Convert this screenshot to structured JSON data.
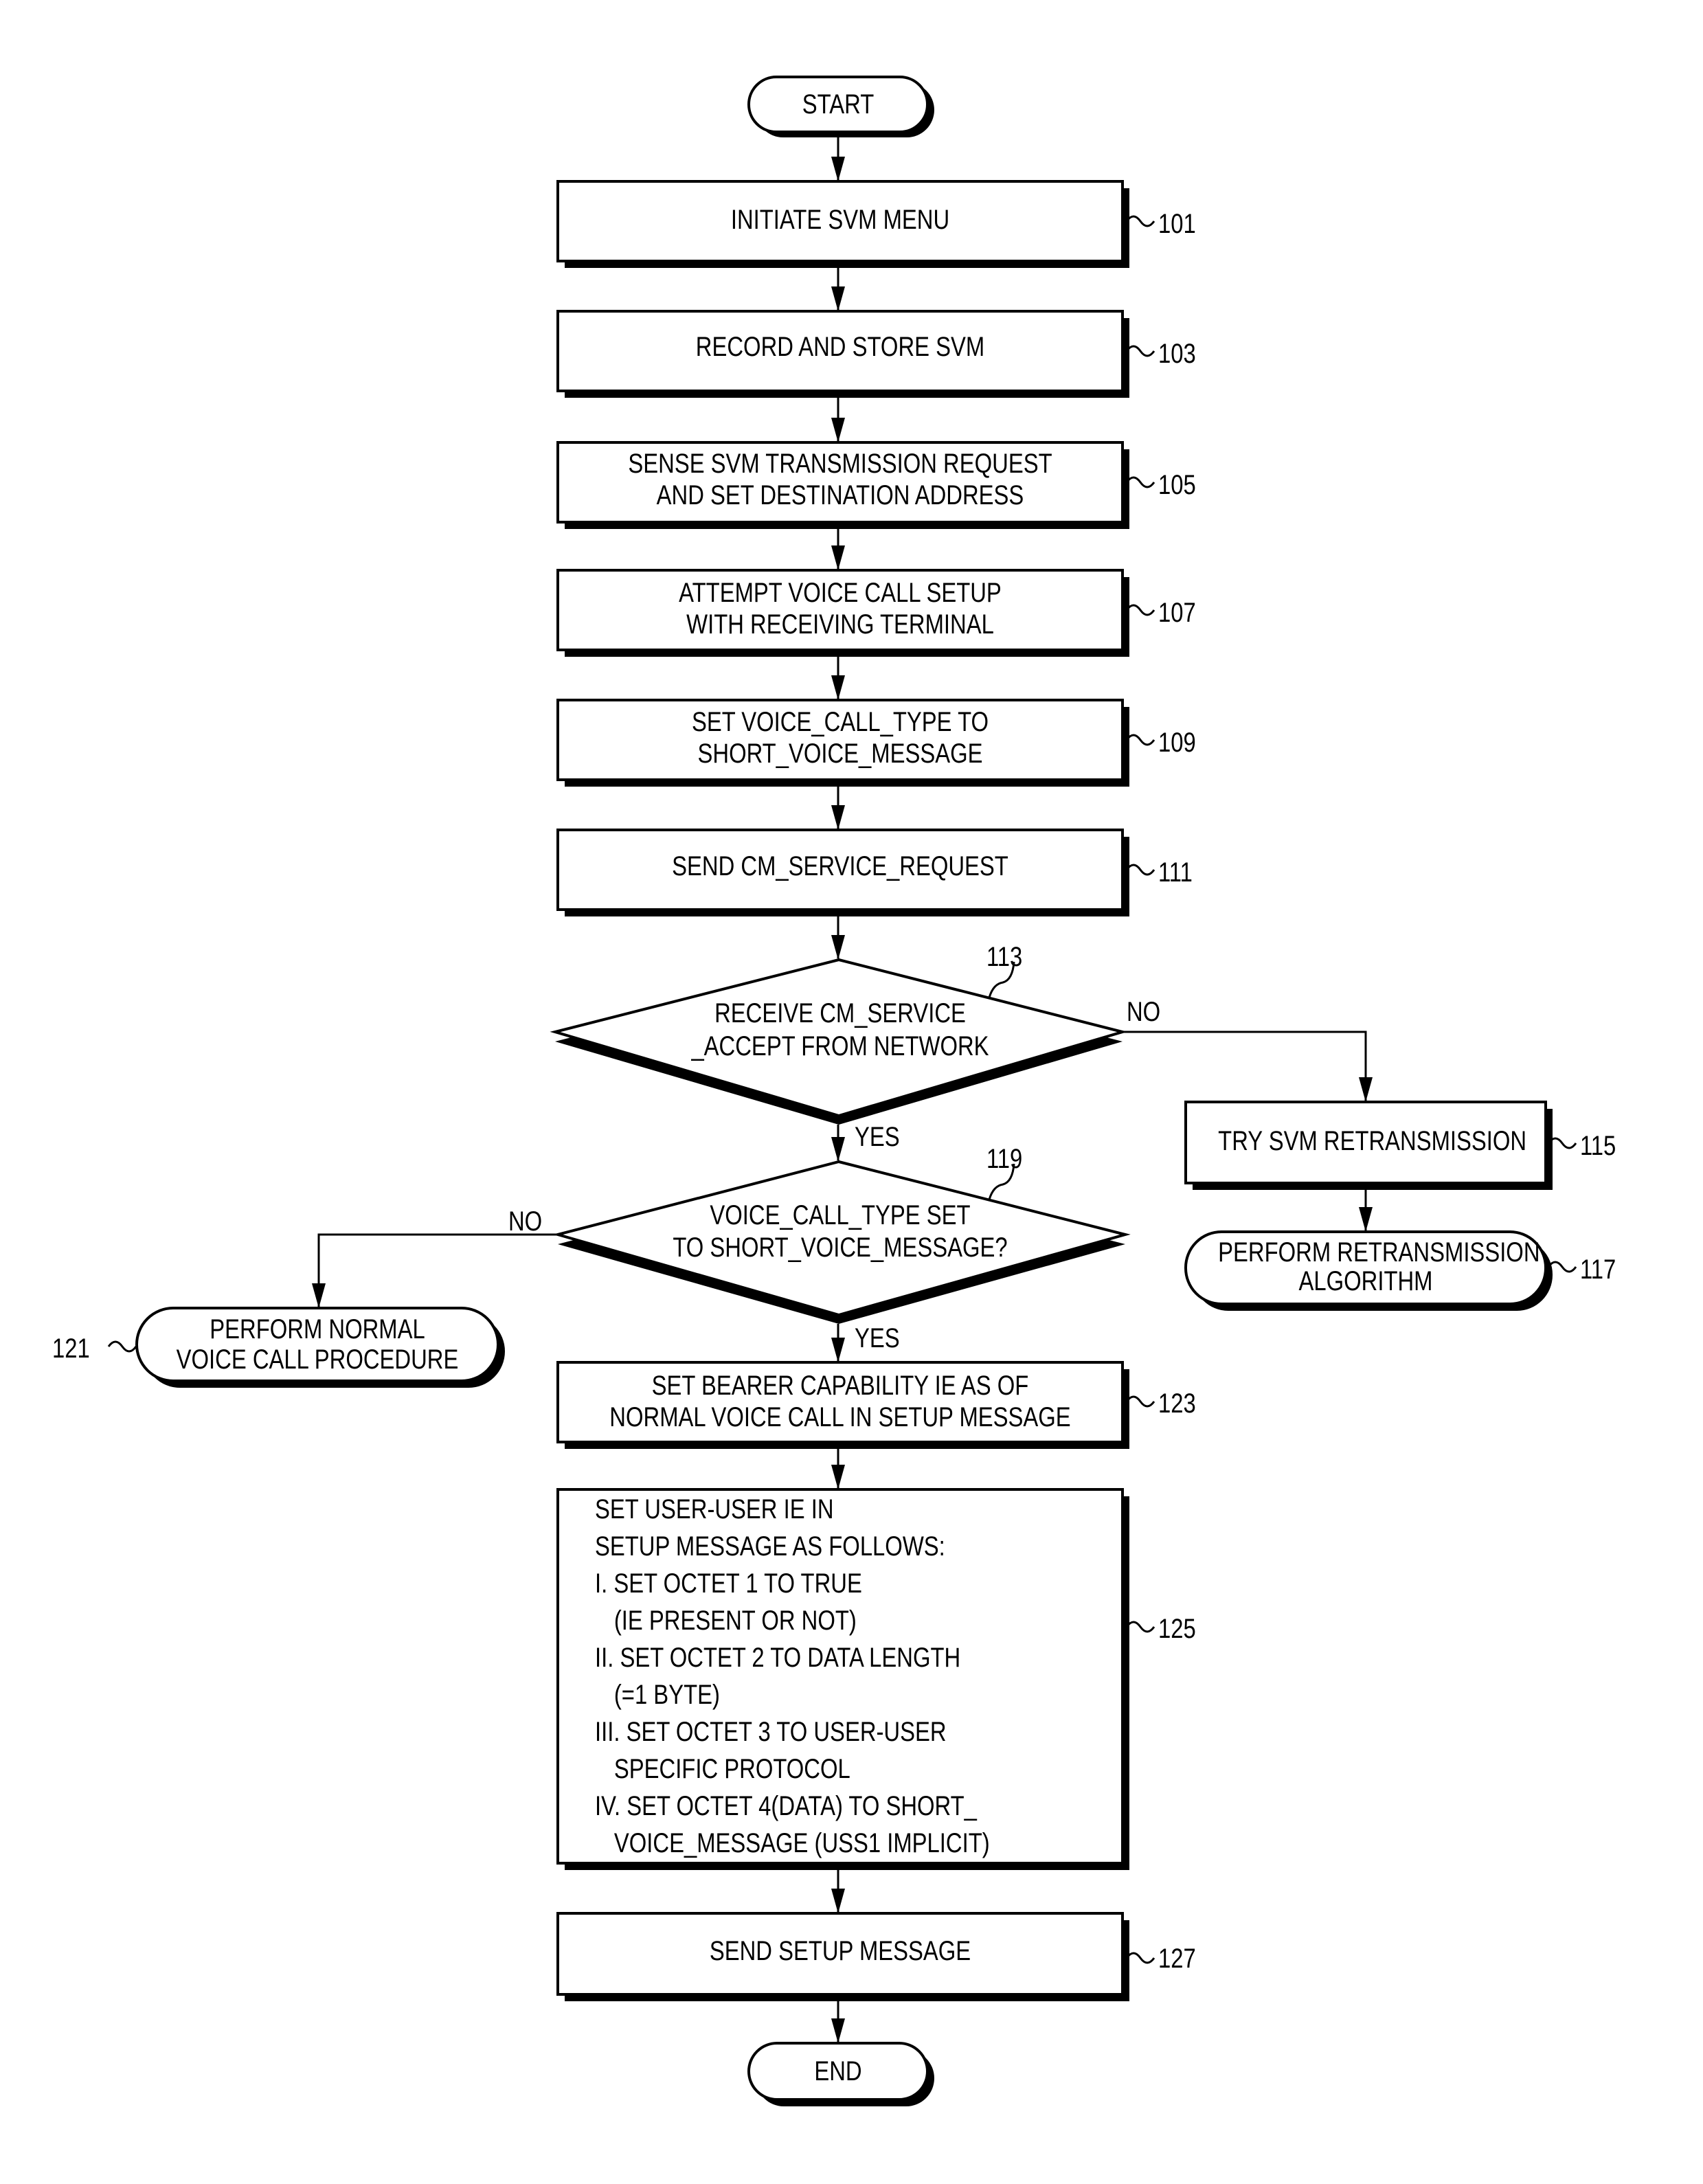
{
  "figure": {
    "start": "START",
    "end": "END",
    "steps": {
      "s101": {
        "ref": "101",
        "lines": [
          "INITIATE SVM MENU"
        ]
      },
      "s103": {
        "ref": "103",
        "lines": [
          "RECORD AND STORE SVM"
        ]
      },
      "s105": {
        "ref": "105",
        "lines": [
          "SENSE SVM TRANSMISSION REQUEST",
          "AND SET DESTINATION ADDRESS"
        ]
      },
      "s107": {
        "ref": "107",
        "lines": [
          "ATTEMPT VOICE CALL SETUP",
          "WITH RECEIVING TERMINAL"
        ]
      },
      "s109": {
        "ref": "109",
        "lines": [
          "SET VOICE_CALL_TYPE TO",
          "SHORT_VOICE_MESSAGE"
        ]
      },
      "s111": {
        "ref": "111",
        "lines": [
          "SEND CM_SERVICE_REQUEST"
        ]
      },
      "d113": {
        "ref": "113",
        "lines": [
          "RECEIVE CM_SERVICE",
          "_ACCEPT FROM NETWORK"
        ],
        "yes": "YES",
        "no": "NO"
      },
      "s115": {
        "ref": "115",
        "lines": [
          "TRY SVM RETRANSMISSION"
        ]
      },
      "t117": {
        "ref": "117",
        "lines": [
          "PERFORM RETRANSMISSION",
          "ALGORITHM"
        ]
      },
      "d119": {
        "ref": "119",
        "lines": [
          "VOICE_CALL_TYPE SET",
          "TO SHORT_VOICE_MESSAGE?"
        ],
        "yes": "YES",
        "no": "NO"
      },
      "t121": {
        "ref": "121",
        "lines": [
          "PERFORM NORMAL",
          "VOICE CALL PROCEDURE"
        ]
      },
      "s123": {
        "ref": "123",
        "lines": [
          "SET BEARER CAPABILITY IE AS OF",
          "NORMAL VOICE CALL IN SETUP MESSAGE"
        ]
      },
      "s125": {
        "ref": "125",
        "lines": [
          "SET USER-USER IE IN",
          "SETUP MESSAGE AS FOLLOWS:",
          "I. SET OCTET 1 TO TRUE",
          "(IE PRESENT OR NOT)",
          "II. SET OCTET 2 TO DATA LENGTH",
          "(=1 BYTE)",
          "III. SET OCTET 3 TO USER-USER",
          "SPECIFIC PROTOCOL",
          "IV. SET OCTET 4(DATA) TO  SHORT_",
          "VOICE_MESSAGE (USS1 IMPLICIT)"
        ]
      },
      "s127": {
        "ref": "127",
        "lines": [
          "SEND SETUP MESSAGE"
        ]
      }
    }
  }
}
